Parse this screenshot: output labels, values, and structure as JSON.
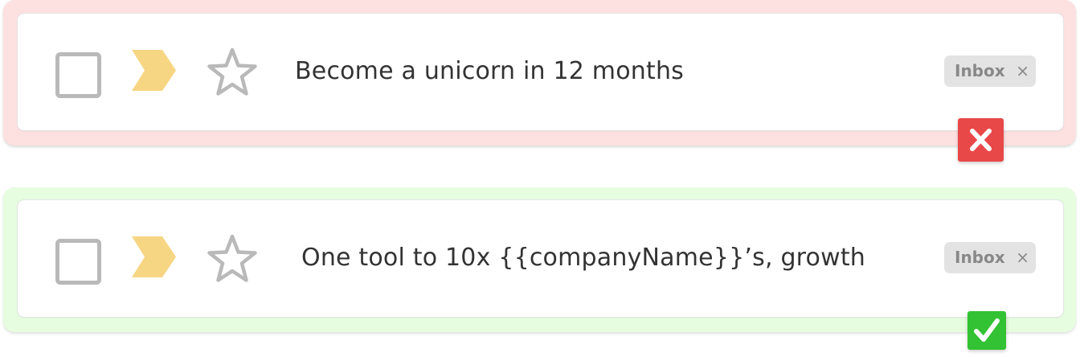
{
  "rows": [
    {
      "subject": "Become a unicorn in 12 months",
      "chip_label": "Inbox",
      "chip_close": "×",
      "verdict_icon": "x-icon",
      "panel_color": "#fde0e0",
      "verdict_color": "#e94848"
    },
    {
      "subject": "One tool to 10x {{companyName}}’s, growth",
      "chip_label": "Inbox",
      "chip_close": "×",
      "verdict_icon": "checkmark-icon",
      "panel_color": "#e6fde0",
      "verdict_color": "#33c233"
    }
  ],
  "colors": {
    "label_tag": "#f7d683",
    "icon_gray": "#b9b9b9"
  }
}
